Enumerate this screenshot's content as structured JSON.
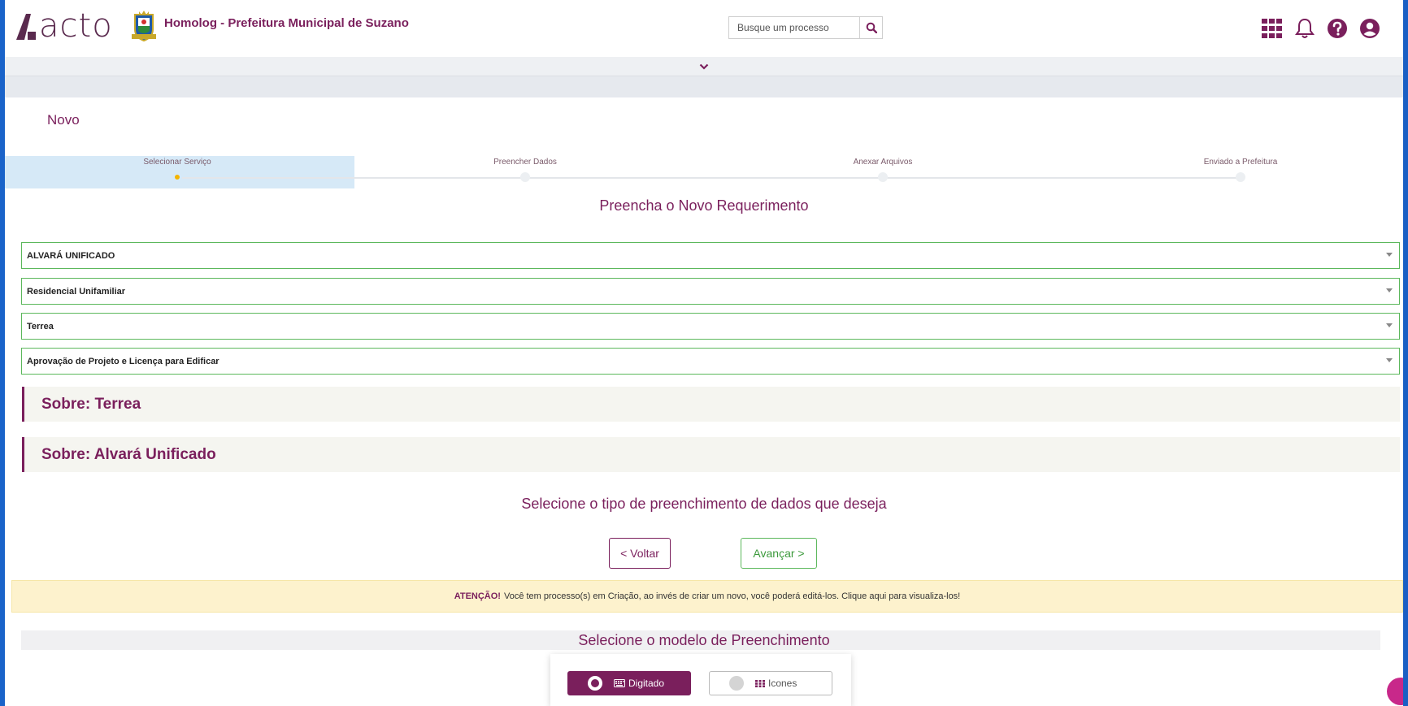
{
  "header": {
    "brand": "acto",
    "org_title": "Homolog - Prefeitura Municipal de Suzano",
    "search_placeholder": "Busque um processo"
  },
  "page": {
    "title": "Novo",
    "heading": "Preencha o Novo Requerimento"
  },
  "stepper": {
    "steps": [
      {
        "label": "Selecionar Serviço"
      },
      {
        "label": "Preencher Dados"
      },
      {
        "label": "Anexar Arquivos"
      },
      {
        "label": "Enviado a Prefeitura"
      }
    ]
  },
  "selects": [
    {
      "value": "ALVARÁ UNIFICADO"
    },
    {
      "value": "Residencial Unifamiliar"
    },
    {
      "value": "Terrea"
    },
    {
      "value": "Aprovação de Projeto e Licença para Edificar"
    }
  ],
  "about": [
    {
      "title": "Sobre: Terrea"
    },
    {
      "title": "Sobre: Alvará Unificado"
    }
  ],
  "fill_type": {
    "heading": "Selecione o tipo de preenchimento de dados que deseja",
    "back_label": "< Voltar",
    "next_label": "Avançar >"
  },
  "alert": {
    "strong": "ATENÇÃO!",
    "text": "Você tem processo(s) em Criação, ao invés de criar um novo, você poderá editá-los. Clique aqui para visualiza-los!"
  },
  "model": {
    "heading": "Selecione o modelo de Preenchimento",
    "option_typed": "Digitado",
    "option_icons": "Icones"
  },
  "colors": {
    "brand": "#7a1f5c",
    "success": "#5cb85c",
    "alert_bg": "#fdf2cd",
    "step_active": "#d6e9f7"
  }
}
